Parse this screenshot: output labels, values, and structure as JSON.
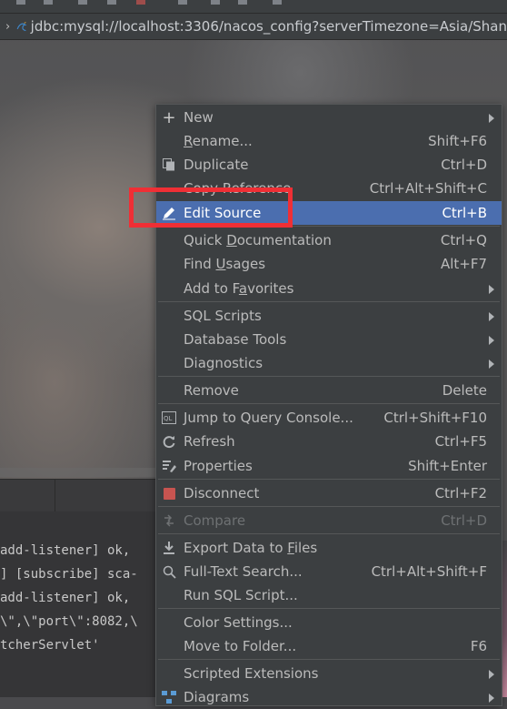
{
  "path_bar": {
    "chevron": "›",
    "connection_url": "jdbc:mysql://localhost:3306/nacos_config?serverTimezone=Asia/Shan"
  },
  "console_lines": [
    "add-listener] ok,",
    "] [subscribe] sca-",
    "add-listener] ok,",
    "\\\",\\\"port\\\":8082,\\",
    "tcherServlet'"
  ],
  "menu": {
    "items": [
      {
        "label": "New",
        "shortcut": "",
        "icon": "plus-icon",
        "submenu": true
      },
      {
        "label_pre": "",
        "label_u": "R",
        "label_post": "ename...",
        "shortcut": "Shift+F6",
        "icon": ""
      },
      {
        "label": "Duplicate",
        "shortcut": "Ctrl+D",
        "icon": "duplicate-icon"
      },
      {
        "label": "Copy Reference",
        "shortcut": "Ctrl+Alt+Shift+C",
        "icon": ""
      },
      {
        "label": "Edit Source",
        "shortcut": "Ctrl+B",
        "icon": "pencil-icon",
        "selected": true
      },
      {
        "label_pre": "Quick ",
        "label_u": "D",
        "label_post": "ocumentation",
        "shortcut": "Ctrl+Q",
        "icon": ""
      },
      {
        "label_pre": "Find ",
        "label_u": "U",
        "label_post": "sages",
        "shortcut": "Alt+F7",
        "icon": ""
      },
      {
        "label_pre": "Add to F",
        "label_u": "a",
        "label_post": "vorites",
        "shortcut": "",
        "icon": "",
        "submenu": true
      },
      {
        "label": "SQL Scripts",
        "shortcut": "",
        "icon": "",
        "submenu": true
      },
      {
        "label": "Database Tools",
        "shortcut": "",
        "icon": "",
        "submenu": true
      },
      {
        "label": "Diagnostics",
        "shortcut": "",
        "icon": "",
        "submenu": true
      },
      {
        "label": "Remove",
        "shortcut": "Delete",
        "icon": ""
      },
      {
        "label": "Jump to Query Console...",
        "shortcut": "Ctrl+Shift+F10",
        "icon": "query-console-icon"
      },
      {
        "label": "Refresh",
        "shortcut": "Ctrl+F5",
        "icon": "refresh-icon"
      },
      {
        "label": "Properties",
        "shortcut": "Shift+Enter",
        "icon": "properties-icon"
      },
      {
        "label": "Disconnect",
        "shortcut": "Ctrl+F2",
        "icon": "stop-icon"
      },
      {
        "label": "Compare",
        "shortcut": "Ctrl+D",
        "icon": "compare-icon",
        "disabled": true
      },
      {
        "label_pre": "Export Data to ",
        "label_u": "F",
        "label_post": "iles",
        "shortcut": "",
        "icon": "export-icon"
      },
      {
        "label": "Full-Text Search...",
        "shortcut": "Ctrl+Alt+Shift+F",
        "icon": "search-icon"
      },
      {
        "label": "Run SQL Script...",
        "shortcut": "",
        "icon": ""
      },
      {
        "label": "Color Settings...",
        "shortcut": "",
        "icon": ""
      },
      {
        "label": "Move to Folder...",
        "shortcut": "F6",
        "icon": ""
      },
      {
        "label": "Scripted Extensions",
        "shortcut": "",
        "icon": "",
        "submenu": true
      },
      {
        "label": "Diagrams",
        "shortcut": "",
        "icon": "diagram-icon",
        "submenu": true
      }
    ]
  },
  "colors": {
    "menu_bg": "#3c3f41",
    "selection": "#4b6eaf",
    "highlight_box": "#ef2f35",
    "disconnect_icon": "#c75450"
  }
}
